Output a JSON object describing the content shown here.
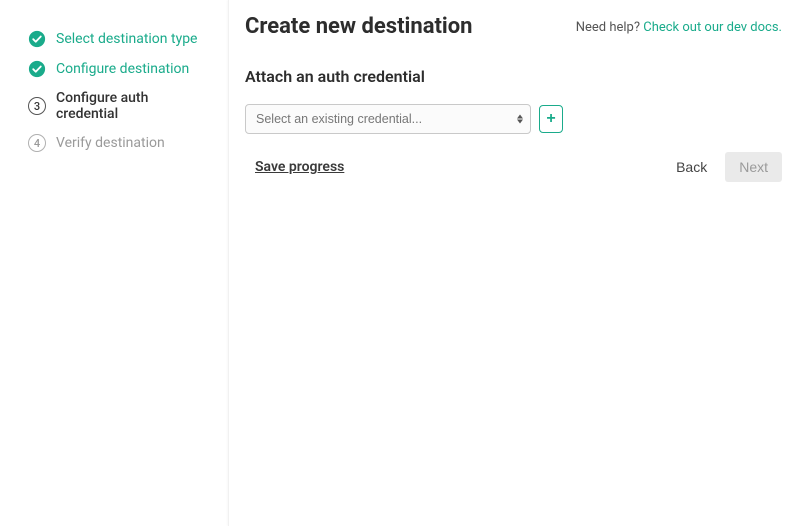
{
  "sidebar": {
    "steps": [
      {
        "label": "Select destination type",
        "state": "done"
      },
      {
        "label": "Configure destination",
        "state": "done"
      },
      {
        "label": "Configure auth credential",
        "number": "3",
        "state": "current"
      },
      {
        "label": "Verify destination",
        "number": "4",
        "state": "inactive"
      }
    ]
  },
  "header": {
    "title": "Create new destination",
    "help_prefix": "Need help? ",
    "help_link": "Check out our dev docs."
  },
  "section": {
    "title": "Attach an auth credential",
    "select_placeholder": "Select an existing credential...",
    "add_label": "+"
  },
  "footer": {
    "save": "Save progress",
    "back": "Back",
    "next": "Next"
  },
  "colors": {
    "accent": "#1aab8b"
  }
}
